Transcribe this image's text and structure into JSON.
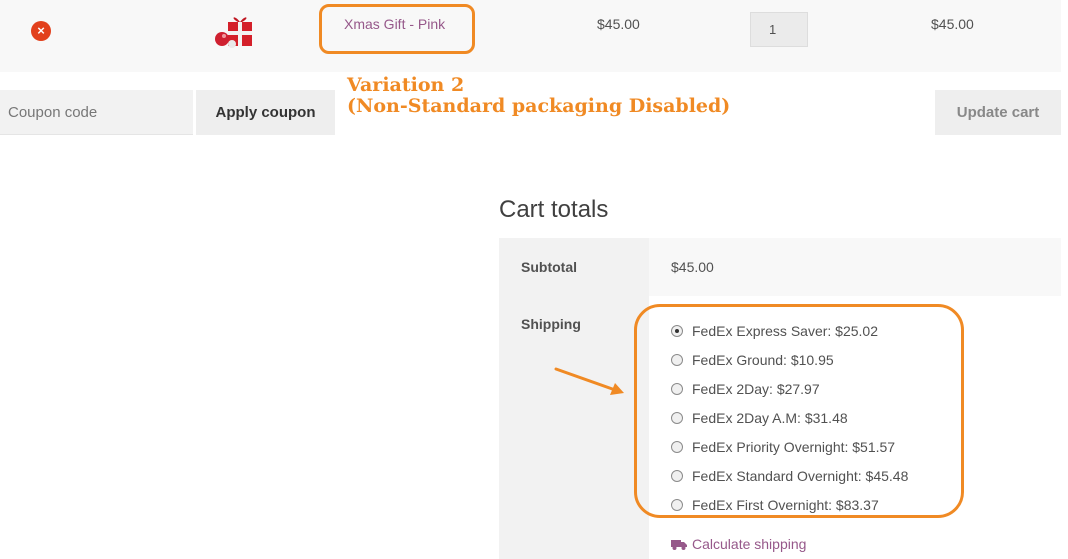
{
  "cart_item": {
    "remove_symbol": "×",
    "product_name": "Xmas Gift - Pink",
    "price": "$45.00",
    "quantity": "1",
    "line_total": "$45.00"
  },
  "coupon": {
    "placeholder": "Coupon code",
    "apply_label": "Apply coupon"
  },
  "update_cart_label": "Update cart",
  "annotation": {
    "line1": "Variation 2",
    "line2": "(Non-Standard packaging Disabled)"
  },
  "totals": {
    "title": "Cart totals",
    "subtotal_label": "Subtotal",
    "subtotal_value": "$45.00",
    "shipping_label": "Shipping",
    "shipping_methods": [
      {
        "label": "FedEx Express Saver: $25.02",
        "checked": true
      },
      {
        "label": "FedEx Ground: $10.95",
        "checked": false
      },
      {
        "label": "FedEx 2Day: $27.97",
        "checked": false
      },
      {
        "label": "FedEx 2Day A.M: $31.48",
        "checked": false
      },
      {
        "label": "FedEx Priority Overnight: $51.57",
        "checked": false
      },
      {
        "label": "FedEx Standard Overnight: $45.48",
        "checked": false
      },
      {
        "label": "FedEx First Overnight: $83.37",
        "checked": false
      }
    ],
    "calculate_shipping_label": "Calculate shipping"
  },
  "colors": {
    "accent": "#96588a",
    "annotation": "#f08a24",
    "remove": "#e2401c"
  },
  "icons": {
    "remove": "close-circle-icon",
    "truck": "truck-icon"
  }
}
